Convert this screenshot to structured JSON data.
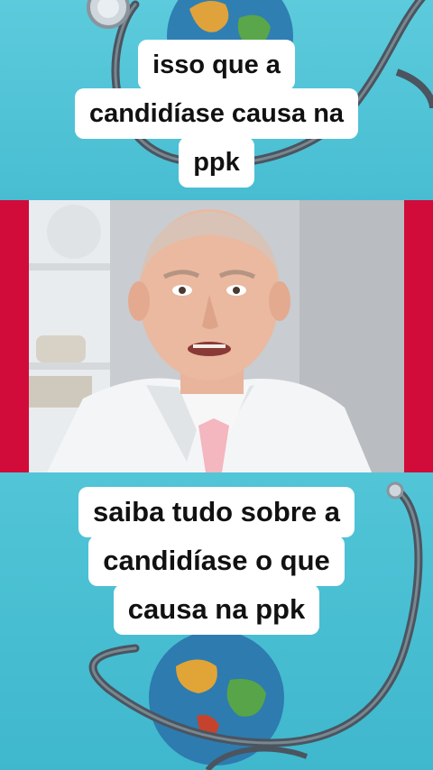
{
  "captions": {
    "top": [
      "isso que a",
      "candidíase causa na",
      "ppk"
    ],
    "bottom": [
      "saiba tudo sobre a",
      "candidíase o que",
      "causa na ppk"
    ]
  },
  "colors": {
    "background": "#55c6d8",
    "accent_band": "#d10c3a",
    "caption_bg": "#ffffff",
    "caption_text": "#111111"
  },
  "icons": [
    "stethoscope-icon",
    "globe-icon"
  ]
}
